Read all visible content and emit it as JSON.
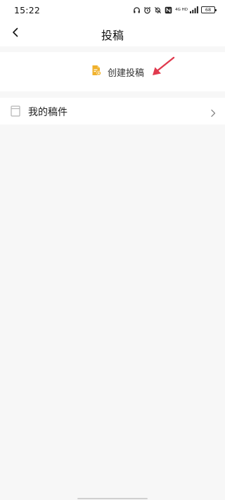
{
  "status_bar": {
    "time": "15:22",
    "network_label": "4G HD",
    "battery": "68",
    "icons": [
      "headset-icon",
      "alarm-icon",
      "mute-bell-icon",
      "nfc-icon",
      "signal-icon",
      "battery-icon"
    ]
  },
  "header": {
    "title": "投稿",
    "back_icon": "back-chevron-icon"
  },
  "create": {
    "label": "创建投稿",
    "icon": "create-document-icon",
    "icon_color": "#f0b12c"
  },
  "annotation": {
    "arrow_color": "#e03a4e"
  },
  "list": {
    "items": [
      {
        "label": "我的稿件",
        "icon": "document-icon",
        "trailing_icon": "chevron-right-icon"
      }
    ]
  },
  "colors": {
    "background": "#f7f7f7",
    "surface": "#ffffff"
  }
}
